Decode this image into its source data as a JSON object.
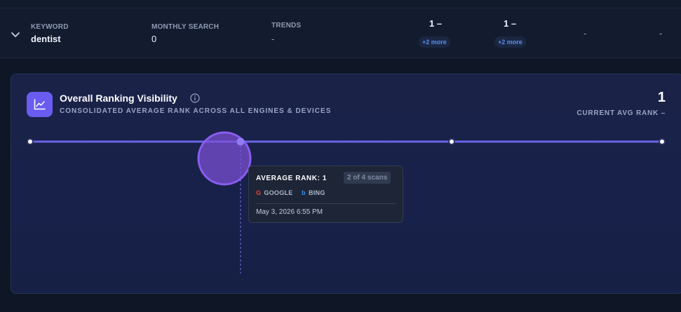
{
  "row": {
    "keyword_label": "KEYWORD",
    "keyword_value": "dentist",
    "monthly_label": "MONTHLY SEARCH",
    "monthly_value": "0",
    "trends_label": "TRENDS",
    "trends_value": "-",
    "rank_cols": [
      {
        "rank": "1 –",
        "more": "+2 more"
      },
      {
        "rank": "1 –",
        "more": "+2 more"
      }
    ],
    "dash_a": "-",
    "dash_b": "-"
  },
  "card": {
    "title": "Overall Ranking Visibility",
    "subtitle": "CONSOLIDATED AVERAGE RANK ACROSS ALL ENGINES & DEVICES",
    "avg_value": "1",
    "avg_label": "CURRENT AVG RANK –",
    "accent": "#6a5cf0",
    "line_color": "#6c63e8"
  },
  "chart_data": {
    "type": "line",
    "series": [
      {
        "values": [
          1,
          1,
          1,
          1
        ]
      }
    ],
    "x": [
      1,
      2,
      3,
      4
    ],
    "active_index": 1
  },
  "tooltip": {
    "title": "AVERAGE RANK: 1",
    "scans": "2 of 4 scans",
    "engines": [
      "GOOGLE",
      "BING"
    ],
    "date": "May 3, 2026 6:55 PM"
  }
}
